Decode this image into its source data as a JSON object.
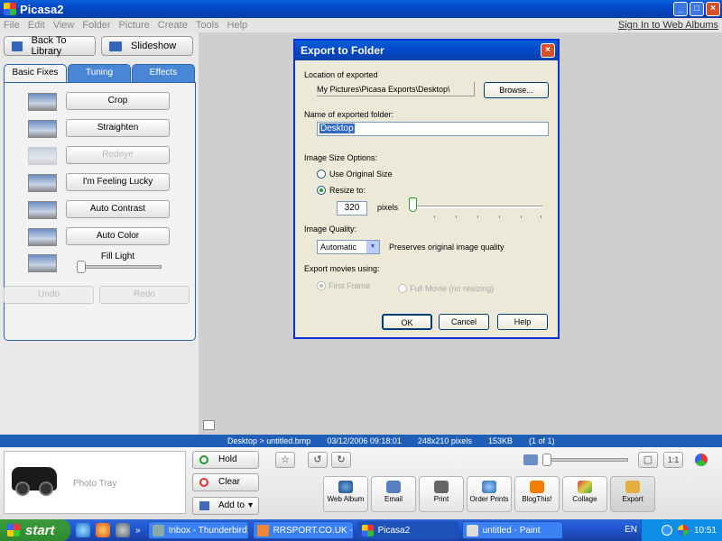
{
  "app": {
    "title": "Picasa2",
    "sign_in": "Sign In to Web Albums"
  },
  "menu": [
    "File",
    "Edit",
    "View",
    "Folder",
    "Picture",
    "Create",
    "Tools",
    "Help"
  ],
  "left": {
    "back_label": "Back To Library",
    "slideshow_label": "Slideshow",
    "tabs": [
      "Basic Fixes",
      "Tuning",
      "Effects"
    ],
    "fixes": [
      "Crop",
      "Straighten",
      "Redeye",
      "I'm Feeling Lucky",
      "Auto Contrast",
      "Auto Color"
    ],
    "fill_light": "Fill Light",
    "undo": "Undo",
    "redo": "Redo"
  },
  "status": {
    "path": "Desktop > untitled.bmp",
    "date": "03/12/2006 09:18:01",
    "dims": "248x210 pixels",
    "size": "153KB",
    "count": "(1 of 1)"
  },
  "tray": {
    "label": "Photo Tray",
    "hold": "Hold",
    "clear": "Clear",
    "add_to": "Add to",
    "add_to_arrow": "▾",
    "star": "☆",
    "rotate_left": "↺",
    "rotate_right": "↻",
    "view_fit": "▢",
    "view_actual": "1:1",
    "actions": [
      "Web Album",
      "Email",
      "Print",
      "Order Prints",
      "BlogThis!",
      "Collage",
      "Export"
    ]
  },
  "dialog": {
    "title": "Export to Folder",
    "close": "×",
    "location_label": "Location of exported",
    "location_value": "My Pictures\\Picasa Exports\\Desktop\\",
    "browse": "Browse...",
    "name_label": "Name of exported folder:",
    "name_value": "Desktop",
    "size_label": "Image Size Options:",
    "use_original": "Use Original Size",
    "resize_to": "Resize to:",
    "resize_value": "320",
    "pixels": "pixels",
    "quality_label": "Image Quality:",
    "quality_value": "Automatic",
    "quality_arrow": "▼",
    "quality_note": "Preserves original image quality",
    "movies_label": "Export movies using:",
    "first_frame": "First Frame",
    "full_movie": "Full Movie (no resizing)",
    "ok": "OK",
    "cancel": "Cancel",
    "help": "Help"
  },
  "taskbar": {
    "start": "start",
    "more": "»",
    "tasks": [
      "Inbox - Thunderbird",
      "RRSPORT.CO.UK - Vi...",
      "Picasa2",
      "untitled - Paint"
    ],
    "lang": "EN",
    "time": "10:51"
  },
  "window_buttons": {
    "minimize": "_",
    "maximize": "□",
    "close": "×"
  }
}
